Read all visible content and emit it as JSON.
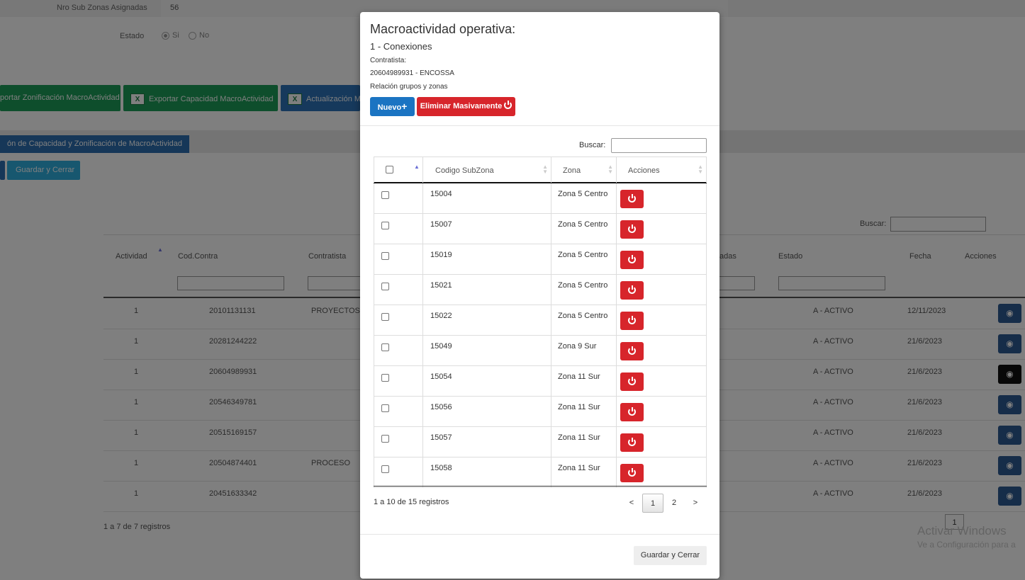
{
  "background": {
    "sub_zonas_label": "Nro Sub Zonas Asignadas",
    "sub_zonas_value": "56",
    "estado_label": "Estado",
    "estado_si": "Si",
    "estado_no": "No",
    "export_zonificacion": "portar Zonificación MacroActividad",
    "export_capacidad": "Exportar Capacidad MacroActividad",
    "actualizacion": "Actualización M",
    "excel_icon_text": "X",
    "tab_label": "ón de Capacidad y Zonificación de MacroActividad",
    "save_close": "Guardar y Cerrar",
    "search_label": "Buscar:",
    "headers": {
      "actividad": "Actividad",
      "cod_contra": "Cod.Contra",
      "contratista": "Contratista",
      "asignadas": "adas",
      "estado": "Estado",
      "fecha": "Fecha",
      "acciones": "Acciones"
    },
    "rows": [
      {
        "actividad": "1",
        "cod": "20101131131",
        "contratista": "PROYECTOS",
        "estado": "A - ACTIVO",
        "fecha": "12/11/2023"
      },
      {
        "actividad": "1",
        "cod": "20281244222",
        "contratista": "",
        "estado": "A - ACTIVO",
        "fecha": "21/6/2023"
      },
      {
        "actividad": "1",
        "cod": "20604989931",
        "contratista": "",
        "estado": "A - ACTIVO",
        "fecha": "21/6/2023"
      },
      {
        "actividad": "1",
        "cod": "20546349781",
        "contratista": "",
        "estado": "A - ACTIVO",
        "fecha": "21/6/2023"
      },
      {
        "actividad": "1",
        "cod": "20515169157",
        "contratista": "",
        "estado": "A - ACTIVO",
        "fecha": "21/6/2023"
      },
      {
        "actividad": "1",
        "cod": "20504874401",
        "contratista": "PROCESO",
        "estado": "A - ACTIVO",
        "fecha": "21/6/2023"
      },
      {
        "actividad": "1",
        "cod": "20451633342",
        "contratista": "",
        "estado": "A - ACTIVO",
        "fecha": "21/6/2023"
      }
    ],
    "footer_info": "1 a 7 de 7 registros",
    "pager_page": "1",
    "watermark_title": "Activar Windows",
    "watermark_sub": "Ve a Configuración para a"
  },
  "modal": {
    "title": "Macroactividad operativa:",
    "subtitle": "1 - Conexiones",
    "contratista_label": "Contratista:",
    "contratista_value": "20604989931 - ENCOSSA",
    "relacion_label": "Relación grupos y zonas",
    "nuevo_button": "Nuevo",
    "nuevo_plus": "+",
    "eliminar_button": "Eliminar Masivamente",
    "search_label": "Buscar:",
    "headers": {
      "codigo": "Codigo SubZona",
      "zona": "Zona",
      "acciones": "Acciones"
    },
    "rows": [
      {
        "codigo": "15004",
        "zona": "Zona 5 Centro"
      },
      {
        "codigo": "15007",
        "zona": "Zona 5 Centro"
      },
      {
        "codigo": "15019",
        "zona": "Zona 5 Centro"
      },
      {
        "codigo": "15021",
        "zona": "Zona 5 Centro"
      },
      {
        "codigo": "15022",
        "zona": "Zona 5 Centro"
      },
      {
        "codigo": "15049",
        "zona": "Zona 9 Sur"
      },
      {
        "codigo": "15054",
        "zona": "Zona 11 Sur"
      },
      {
        "codigo": "15056",
        "zona": "Zona 11 Sur"
      },
      {
        "codigo": "15057",
        "zona": "Zona 11 Sur"
      },
      {
        "codigo": "15058",
        "zona": "Zona 11 Sur"
      }
    ],
    "info": "1 a 10 de 15 registros",
    "pagination": {
      "prev": "<",
      "pages": [
        "1",
        "2"
      ],
      "next": ">"
    },
    "save_close": "Guardar y Cerrar"
  }
}
